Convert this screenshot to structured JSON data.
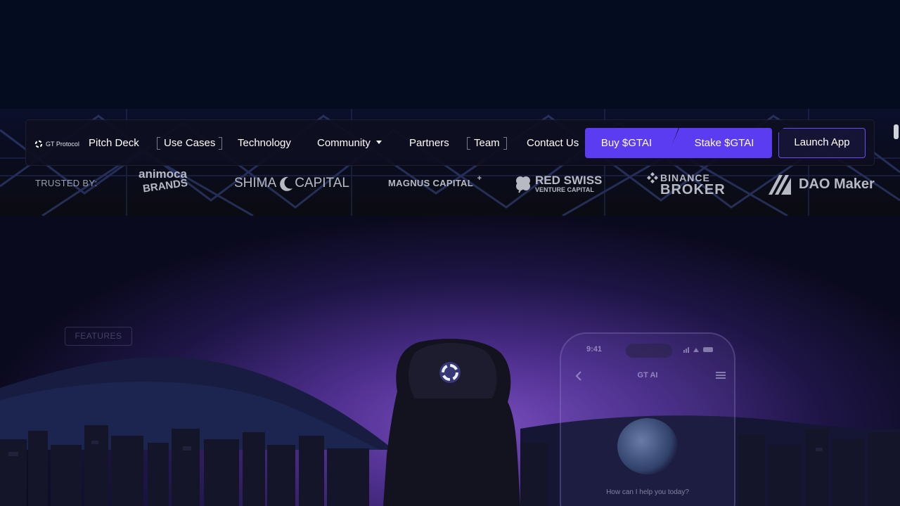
{
  "nav": {
    "logo_text": "GT Protocol",
    "items": [
      {
        "label": "Pitch Deck"
      },
      {
        "label": "Use Cases"
      },
      {
        "label": "Technology"
      },
      {
        "label": "Community"
      },
      {
        "label": "Partners"
      },
      {
        "label": "Team"
      },
      {
        "label": "Contact Us"
      }
    ],
    "buy_label": "Buy $GTAI",
    "stake_label": "Stake $GTAI",
    "launch_label": "Launch App"
  },
  "trusted": {
    "label": "TRUSTED BY:",
    "logos": [
      {
        "line1": "animoca",
        "line2": "BRANDS",
        "icon": "animoca-logo"
      },
      {
        "left": "SHIMA",
        "right": "CAPITAL",
        "icon": "shima-capital-logo"
      },
      {
        "text": "MAGNUS CAPITAL",
        "mark": "+",
        "icon": "magnus-capital-logo"
      },
      {
        "line1": "RED SWISS",
        "line2": "VENTURE CAPITAL",
        "icon": "clover-icon"
      },
      {
        "line1": "BINANCE",
        "line2": "BROKER",
        "icon": "binance-icon"
      },
      {
        "text": "DAO Maker",
        "icon": "dao-maker-icon"
      }
    ]
  },
  "hero": {
    "features_tag": "FEATURES",
    "phone": {
      "time": "9:41",
      "title": "GT AI",
      "prompt": "How can I help you today?"
    }
  },
  "colors": {
    "accent": "#5b3cf0",
    "page_bg": "#040c1e"
  }
}
